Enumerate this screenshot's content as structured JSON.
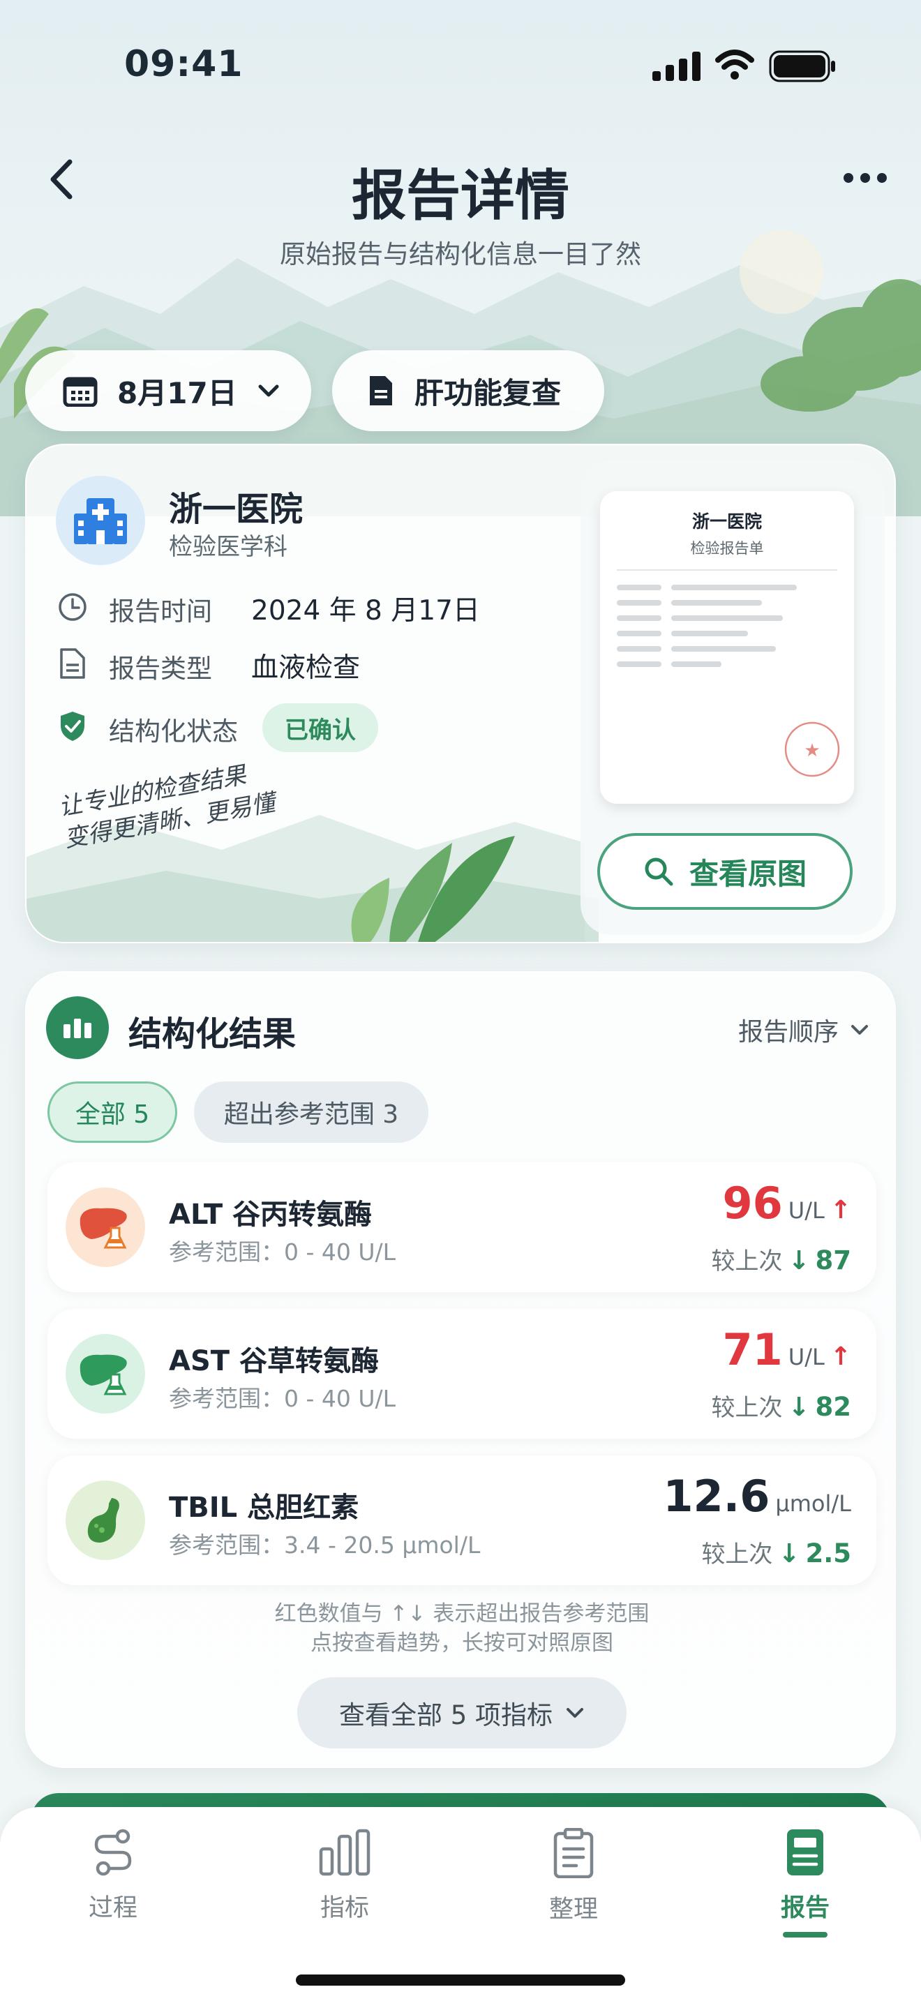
{
  "status_bar": {
    "time": "09:41"
  },
  "header": {
    "title": "报告详情",
    "subtitle": "原始报告与结构化信息一目了然"
  },
  "filters": {
    "date": "8月17日",
    "report_name": "肝功能复查"
  },
  "report_card": {
    "hospital": "浙一医院",
    "department": "检验医学科",
    "time_label": "报告时间",
    "time_value": "2024 年 8 月17日",
    "type_label": "报告类型",
    "type_value": "血液检查",
    "status_label": "结构化状态",
    "status_value": "已确认",
    "slogan_line1": "让专业的检查结果",
    "slogan_line2": "变得更清晰、更易懂",
    "preview_title": "浙一医院",
    "preview_subtitle": "检验报告单",
    "view_original": "查看原图"
  },
  "results": {
    "title": "结构化结果",
    "sort_label": "报告顺序",
    "chips": [
      {
        "label": "全部 5"
      },
      {
        "label": "超出参考范围 3"
      }
    ],
    "items": [
      {
        "name": "ALT 谷丙转氨酶",
        "range": "参考范围：0 - 40 U/L",
        "value": "96",
        "unit": "U/L",
        "prev_label": "较上次",
        "prev_value": "87",
        "abnormal": true
      },
      {
        "name": "AST 谷草转氨酶",
        "range": "参考范围：0 - 40 U/L",
        "value": "71",
        "unit": "U/L",
        "prev_label": "较上次",
        "prev_value": "82",
        "abnormal": true
      },
      {
        "name": "TBIL 总胆红素",
        "range": "参考范围：3.4 - 20.5 µmol/L",
        "value": "12.6",
        "unit": "µmol/L",
        "prev_label": "较上次",
        "prev_value": "2.5",
        "abnormal": false
      }
    ],
    "note_line1": "红色数值与 ↑↓ 表示超出报告参考范围",
    "note_line2": "点按查看趋势，长按可对照原图",
    "view_all": "查看全部 5 项指标"
  },
  "tabbar": {
    "tabs": [
      {
        "label": "过程",
        "icon": "process-icon"
      },
      {
        "label": "指标",
        "icon": "chart-icon"
      },
      {
        "label": "整理",
        "icon": "clipboard-icon"
      },
      {
        "label": "报告",
        "icon": "report-icon",
        "active": true
      }
    ]
  },
  "colors": {
    "accent": "#2c8a5d",
    "alert": "#e0383e",
    "text": "#1c2733"
  }
}
